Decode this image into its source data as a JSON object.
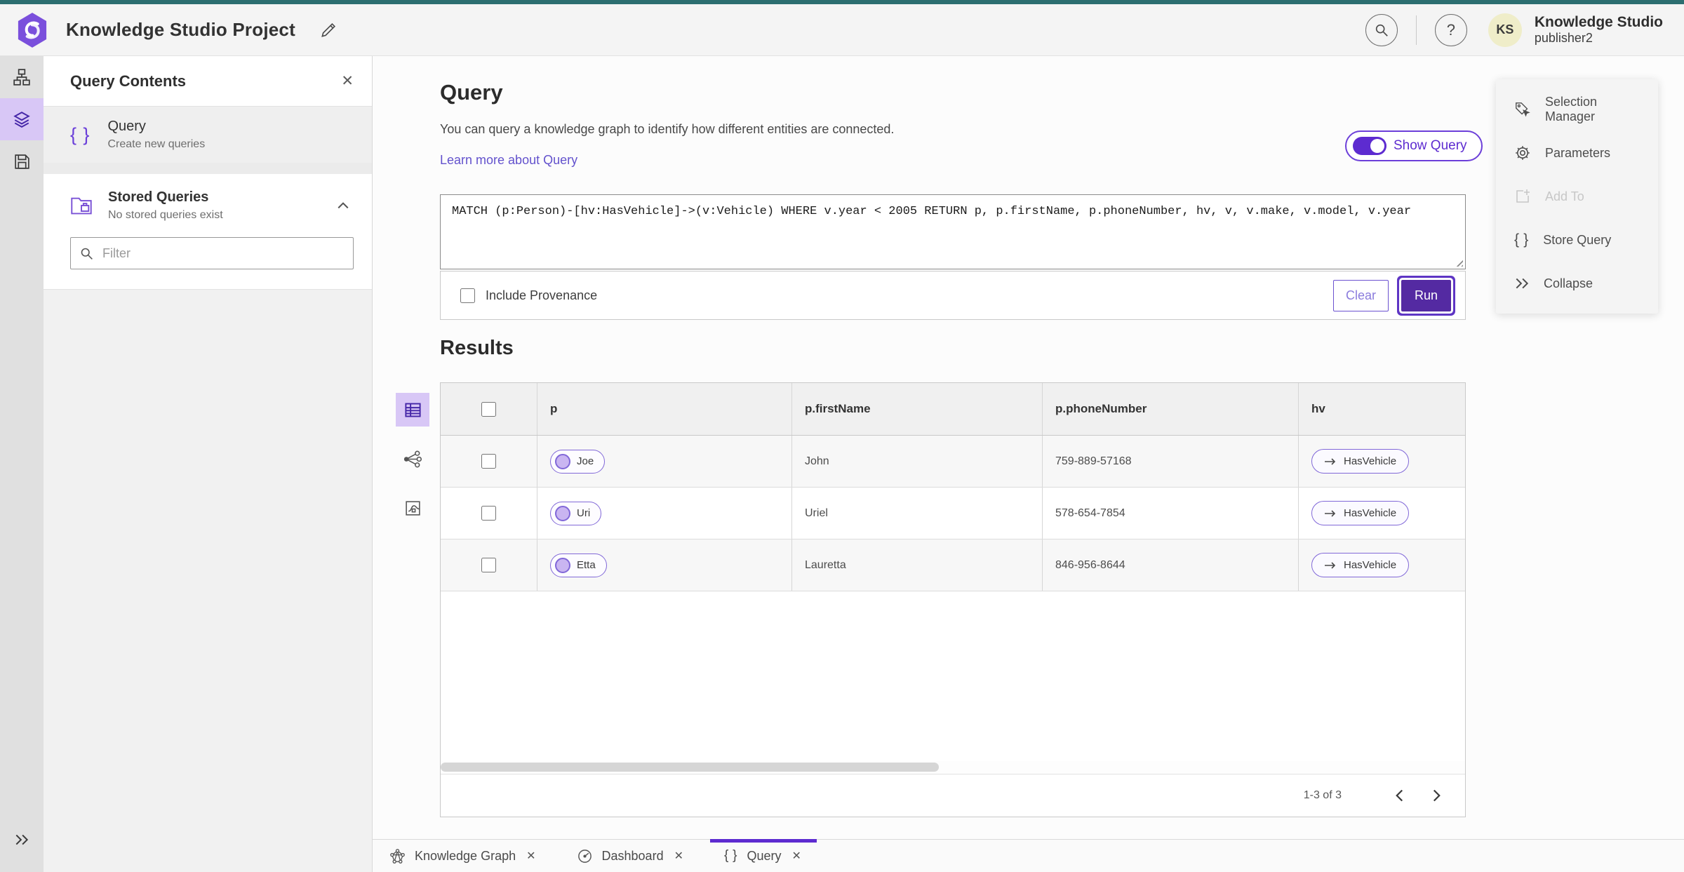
{
  "header": {
    "title": "Knowledge Studio Project",
    "user_initials": "KS",
    "user_name": "Knowledge Studio",
    "user_role": "publisher2"
  },
  "left_panel": {
    "title": "Query Contents",
    "query_item": {
      "title": "Query",
      "subtitle": "Create new queries",
      "icon": "braces-icon"
    },
    "stored_queries": {
      "title": "Stored Queries",
      "subtitle": "No stored queries exist",
      "icon": "folder-icon"
    },
    "filter_placeholder": "Filter"
  },
  "query_section": {
    "title": "Query",
    "description": "You can query a knowledge graph to identify how different entities are connected.",
    "learn_more": "Learn more about Query",
    "show_query_label": "Show Query",
    "show_query_on": true,
    "query_text": "MATCH (p:Person)-[hv:HasVehicle]->(v:Vehicle) WHERE v.year < 2005 RETURN p, p.firstName, p.phoneNumber, hv, v, v.make, v.model, v.year",
    "include_provenance_label": "Include Provenance",
    "include_provenance_checked": false,
    "clear_label": "Clear",
    "run_label": "Run"
  },
  "results": {
    "title": "Results",
    "columns": [
      "p",
      "p.firstName",
      "p.phoneNumber",
      "hv"
    ],
    "rows": [
      {
        "p": "Joe",
        "firstName": "John",
        "phoneNumber": "759-889-57168",
        "hv": "HasVehicle"
      },
      {
        "p": "Uri",
        "firstName": "Uriel",
        "phoneNumber": "578-654-7854",
        "hv": "HasVehicle"
      },
      {
        "p": "Etta",
        "firstName": "Lauretta",
        "phoneNumber": "846-956-8644",
        "hv": "HasVehicle"
      }
    ],
    "pagination": "1-3 of 3",
    "view_modes": [
      "table-view-icon",
      "graph-view-icon",
      "chart-view-icon"
    ],
    "active_view": "table-view-icon"
  },
  "tools_panel": {
    "items": [
      {
        "label": "Selection Manager",
        "icon": "selection-manager-icon",
        "disabled": false
      },
      {
        "label": "Parameters",
        "icon": "gear-icon",
        "disabled": false
      },
      {
        "label": "Add To",
        "icon": "add-to-icon",
        "disabled": true
      },
      {
        "label": "Store Query",
        "icon": "braces-icon",
        "disabled": false
      },
      {
        "label": "Collapse",
        "icon": "double-chevron-right-icon",
        "disabled": false
      }
    ]
  },
  "bottom_tabs": [
    {
      "label": "Knowledge Graph",
      "icon": "graph-icon",
      "active": false
    },
    {
      "label": "Dashboard",
      "icon": "dashboard-icon",
      "active": false
    },
    {
      "label": "Query",
      "icon": "braces-icon",
      "active": true
    }
  ],
  "colors": {
    "accent_purple": "#5d2bd0",
    "run_button": "#542aa2",
    "pill_border": "#8168d8",
    "pill_node_fill": "#c9b5f1",
    "active_icon_bg": "#d8c7f6",
    "top_strip_teal": "#2c6e70",
    "link": "#6352cd",
    "avatar_bg": "#efedc9",
    "header_bg": "#f4f4f4",
    "rail_bg": "#e0e0e0",
    "table_header_bg": "#f0f0f0",
    "row_stripe": "#f7f7f7"
  }
}
